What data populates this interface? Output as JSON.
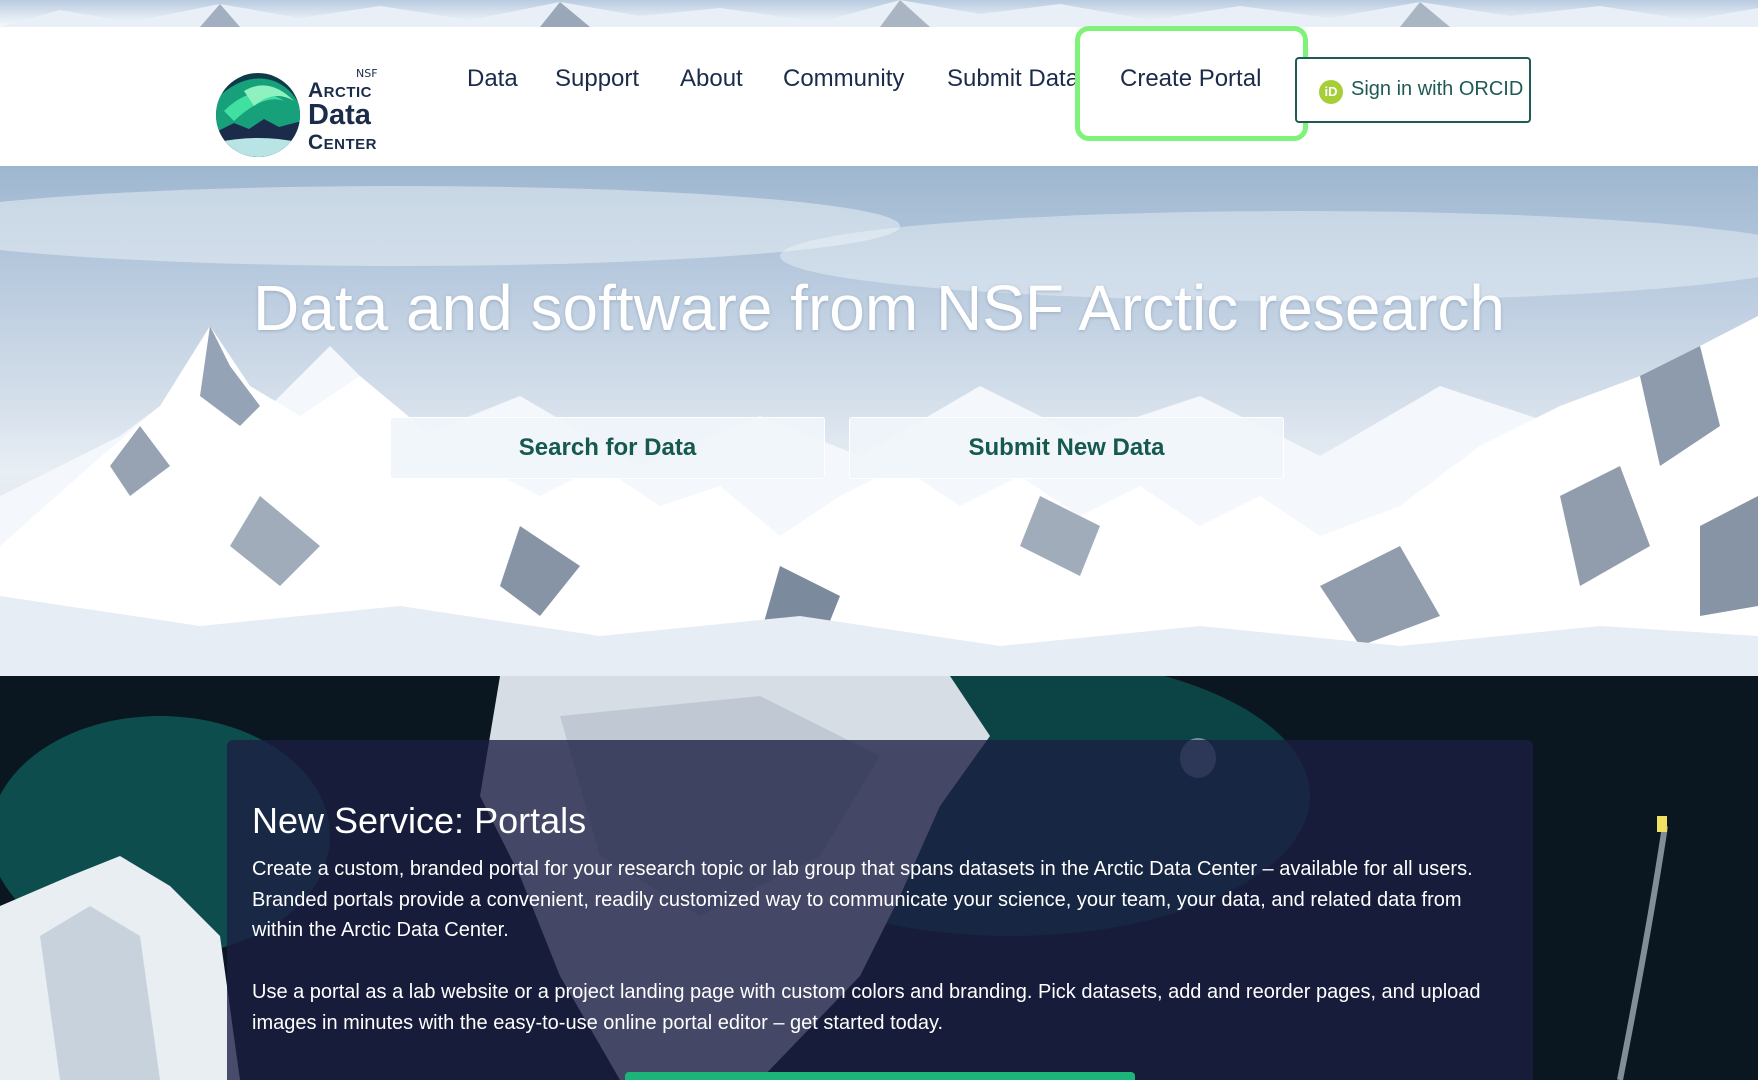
{
  "brand": {
    "nsf": "NSF",
    "arctic": "Arctic",
    "data": "Data",
    "center": "Center"
  },
  "nav": {
    "items": [
      {
        "label": "Data"
      },
      {
        "label": "Support"
      },
      {
        "label": "About"
      },
      {
        "label": "Community"
      },
      {
        "label": "Submit Data"
      },
      {
        "label": "Create Portal"
      }
    ],
    "signin": {
      "icon": "iD",
      "label": "Sign in with ORCID"
    }
  },
  "hero": {
    "title": "Data and software from NSF Arctic research",
    "search_button": "Search for Data",
    "submit_button": "Submit New Data"
  },
  "portals": {
    "title": "New Service: Portals",
    "paragraph1": "Create a custom, branded portal for your research topic or lab group that spans datasets in the Arctic Data Center – available for all users. Branded portals provide a convenient, readily customized way to communicate your science, your team, your data, and related data from within the Arctic Data Center.",
    "paragraph2": "Use a portal as a lab website or a project landing page with custom colors and branding. Pick datasets, add and reorder pages, and upload images in minutes with the easy-to-use online portal editor – get started today."
  },
  "colors": {
    "brand_navy": "#1b2c4a",
    "brand_teal": "#16594f",
    "highlight": "#7ff27a",
    "orcid_green": "#a6ce39",
    "cta_green": "#1db47a"
  }
}
